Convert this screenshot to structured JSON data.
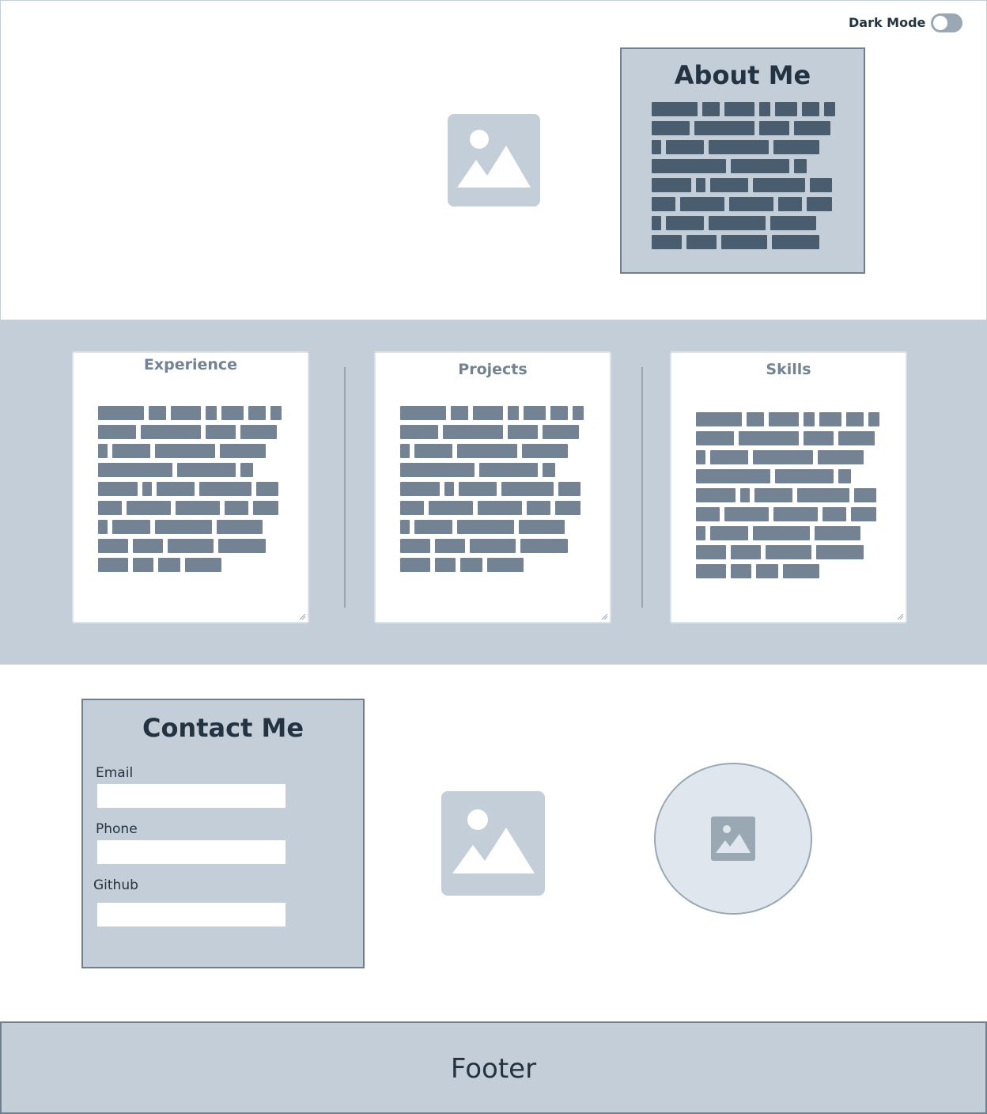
{
  "header": {
    "dark_mode_label": "Dark Mode",
    "dark_mode_on": false
  },
  "about": {
    "title": "About Me"
  },
  "sections": {
    "experience_title": "Experience",
    "projects_title": "Projects",
    "skills_title": "Skills"
  },
  "contact": {
    "title": "Contact Me",
    "email_label": "Email",
    "email_value": "",
    "phone_label": "Phone",
    "phone_value": "",
    "github_label": "Github",
    "github_value": ""
  },
  "footer": {
    "text": "Footer"
  },
  "colors": {
    "dark_text": "#243342",
    "placeholder_dark": "#4a5d6e",
    "placeholder_mid": "#738393",
    "panel": "#c3ced8",
    "border": "#6f7f8e"
  }
}
